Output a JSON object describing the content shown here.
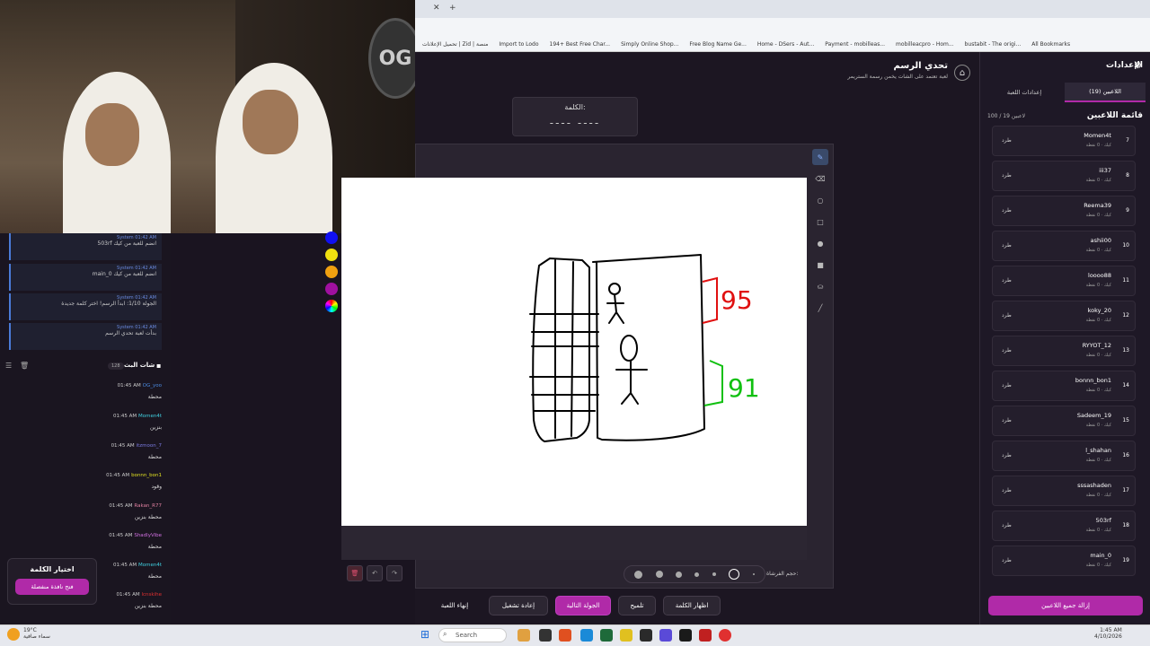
{
  "browser": {
    "tab_plus": "+",
    "bookmarks": [
      "تحميل الإعلانات | Zid | منصة",
      "Import to Lodo",
      "194+ Best Free Char...",
      "Simply Online Shop...",
      "Free Blog Name Ge...",
      "Home - DSers - Aut...",
      "Payment - mobilleas...",
      "mobilleacpro - Hom...",
      "bustabit - The origi...",
      "All Bookmarks"
    ]
  },
  "header": {
    "title": "تحدي الرسم",
    "subtitle": "لعبة تعتمد على الشات يخمن رسمة الستريمر",
    "home_icon": "home-icon"
  },
  "word": {
    "label": "الكلمة:",
    "mask": "---- ----"
  },
  "drawing": {
    "label_top": "95",
    "label_bottom": "91"
  },
  "colors": [
    "#1010f0",
    "#f0e010",
    "#f0a010",
    "#a010a0",
    "rainbow"
  ],
  "toolbar": {
    "brush_size_label": "حجم الفرشاة:"
  },
  "actions": {
    "end_game": "إنهاء اللعبة",
    "restart": "إعادة تشغيل",
    "next_round": "الجولة التالية",
    "hint": "تلميح",
    "reveal_word": "اظهار الكلمة"
  },
  "word_choice": {
    "title": "اختيار الكلمة",
    "button": "فتح نافذة منفصلة"
  },
  "system_logs": [
    {
      "meta": "System  01:42 AM",
      "text": "503rf انضم للعبة من كيك"
    },
    {
      "meta": "System  01:42 AM",
      "text": "main_0 انضم للعبة من كيك"
    },
    {
      "meta": "System  01:42 AM",
      "text": "الجولة 1/10: ابدأ الرسم! اختر كلمة جديدة"
    },
    {
      "meta": "System  01:42 AM",
      "text": "بدأت لعبة تحدي الرسم"
    }
  ],
  "chat": {
    "title": "شات البث",
    "count": "128",
    "messages": [
      {
        "user": "OG_yoo",
        "time": "01:45 AM",
        "text": "محطة",
        "color": "#4a8ae0"
      },
      {
        "user": "Momen4t",
        "time": "01:45 AM",
        "text": "بنزين",
        "color": "#40d0e0"
      },
      {
        "user": "itzmoon_7",
        "time": "01:45 AM",
        "text": "محطة",
        "color": "#7a7ae0"
      },
      {
        "user": "bonnn_bon1",
        "time": "01:45 AM",
        "text": "وقود",
        "color": "#e0e020"
      },
      {
        "user": "Rakan_R77",
        "time": "01:45 AM",
        "text": "محطة بنزين",
        "color": "#e080a0"
      },
      {
        "user": "ShadlyVibe",
        "time": "01:45 AM",
        "text": "محطة",
        "color": "#d070e0"
      },
      {
        "user": "Momen4t",
        "time": "01:45 AM",
        "text": "محطة",
        "color": "#40d0e0"
      },
      {
        "user": "lcnskihe",
        "time": "01:45 AM",
        "text": "محطة بنزين",
        "color": "#e03030"
      }
    ]
  },
  "sidebar": {
    "title": "الإعدادات",
    "tabs": [
      "إعدادات اللعبة",
      "اللاعبين (19)"
    ],
    "list_title": "قائمة اللاعبين",
    "count": "100 / 19 لاعبين",
    "kick_label": "طرد",
    "remove_all": "إزالة جميع اللاعبين",
    "players": [
      {
        "num": "7",
        "name": "Momen4t",
        "sub": "كيك · 0 نقطة"
      },
      {
        "num": "8",
        "name": "iii37",
        "sub": "كيك · 0 نقطة"
      },
      {
        "num": "9",
        "name": "Reema39",
        "sub": "كيك · 0 نقطة"
      },
      {
        "num": "10",
        "name": "ashii00",
        "sub": "كيك · 0 نقطة"
      },
      {
        "num": "11",
        "name": "loooo88",
        "sub": "كيك · 0 نقطة"
      },
      {
        "num": "12",
        "name": "koky_20",
        "sub": "كيك · 0 نقطة"
      },
      {
        "num": "13",
        "name": "RYYOT_12",
        "sub": "كيك · 0 نقطة"
      },
      {
        "num": "14",
        "name": "bonnn_bon1",
        "sub": "كيك · 0 نقطة"
      },
      {
        "num": "15",
        "name": "Sadeem_19",
        "sub": "كيك · 0 نقطة"
      },
      {
        "num": "16",
        "name": "l_shahan",
        "sub": "كيك · 0 نقطة"
      },
      {
        "num": "17",
        "name": "sssashaden",
        "sub": "كيك · 0 نقطة"
      },
      {
        "num": "18",
        "name": "503rf",
        "sub": "كيك · 0 نقطة"
      },
      {
        "num": "19",
        "name": "main_0",
        "sub": "كيك · 0 نقطة"
      }
    ]
  },
  "taskbar": {
    "search": "Search",
    "weather": "19°C",
    "weather_sub": "سماء صافية",
    "time": "1:45 AM",
    "date": "4/10/2026"
  }
}
